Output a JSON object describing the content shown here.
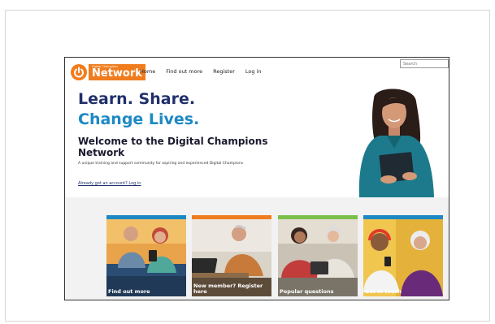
{
  "logo": {
    "small": "Digital Champions",
    "big": "Network"
  },
  "nav": {
    "items": [
      "Home",
      "Find out more",
      "Register",
      "Log in"
    ]
  },
  "search": {
    "placeholder": "Search"
  },
  "hero": {
    "line1": "Learn. Share.",
    "line2": "Change Lives.",
    "heading": "Welcome to the Digital Champions Network",
    "subtitle": "A unique training and support community for aspiring and experienced Digital Champions",
    "login_link": "Already got an account? Log in"
  },
  "cards": [
    {
      "label": "Find out more",
      "bar_color": "#1d89c4"
    },
    {
      "label": "New member? Register here",
      "bar_color": "#f07c1e"
    },
    {
      "label": "Popular questions",
      "bar_color": "#7cc04b"
    },
    {
      "label": "Get in touch",
      "bar_color": "#1d89c4"
    }
  ],
  "colors": {
    "navy": "#20306b",
    "blue": "#1d89c4",
    "orange": "#f07c1e",
    "green": "#7cc04b"
  }
}
